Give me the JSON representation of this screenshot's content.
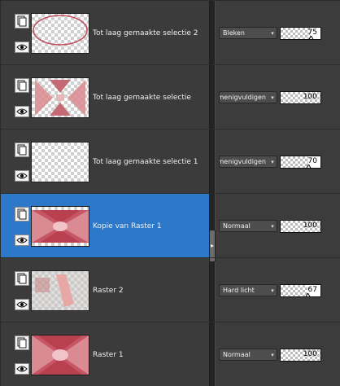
{
  "layers": [
    {
      "name": "Tot laag gemaakte selectie 2",
      "blend_mode": "Bleken",
      "opacity": 75,
      "selected": false,
      "thumb": "ellipse"
    },
    {
      "name": "Tot laag gemaakte selectie",
      "blend_mode": "Vermenigvuldigen",
      "opacity": 100,
      "selected": false,
      "thumb": "bowtie"
    },
    {
      "name": "Tot laag gemaakte selectie 1",
      "blend_mode": "Vermenigvuldigen",
      "opacity": 70,
      "selected": false,
      "thumb": "empty"
    },
    {
      "name": "Kopie van Raster 1",
      "blend_mode": "Normaal",
      "opacity": 100,
      "selected": true,
      "thumb": "pattern"
    },
    {
      "name": "Raster 2",
      "blend_mode": "Hard licht",
      "opacity": 67,
      "selected": false,
      "thumb": "stripe"
    },
    {
      "name": "Raster 1",
      "blend_mode": "Normaal",
      "opacity": 100,
      "selected": false,
      "thumb": "pattern-full"
    }
  ],
  "colors": {
    "selected_row": "#2d78c8",
    "accent_red": "#c0505f",
    "panel_bg": "#3c3c3c"
  },
  "icons": {
    "layer_type": "layer-stack-icon",
    "visibility": "eye-icon",
    "dropdown": "chevron-down-icon",
    "splitter": "chevron-right-icon"
  }
}
